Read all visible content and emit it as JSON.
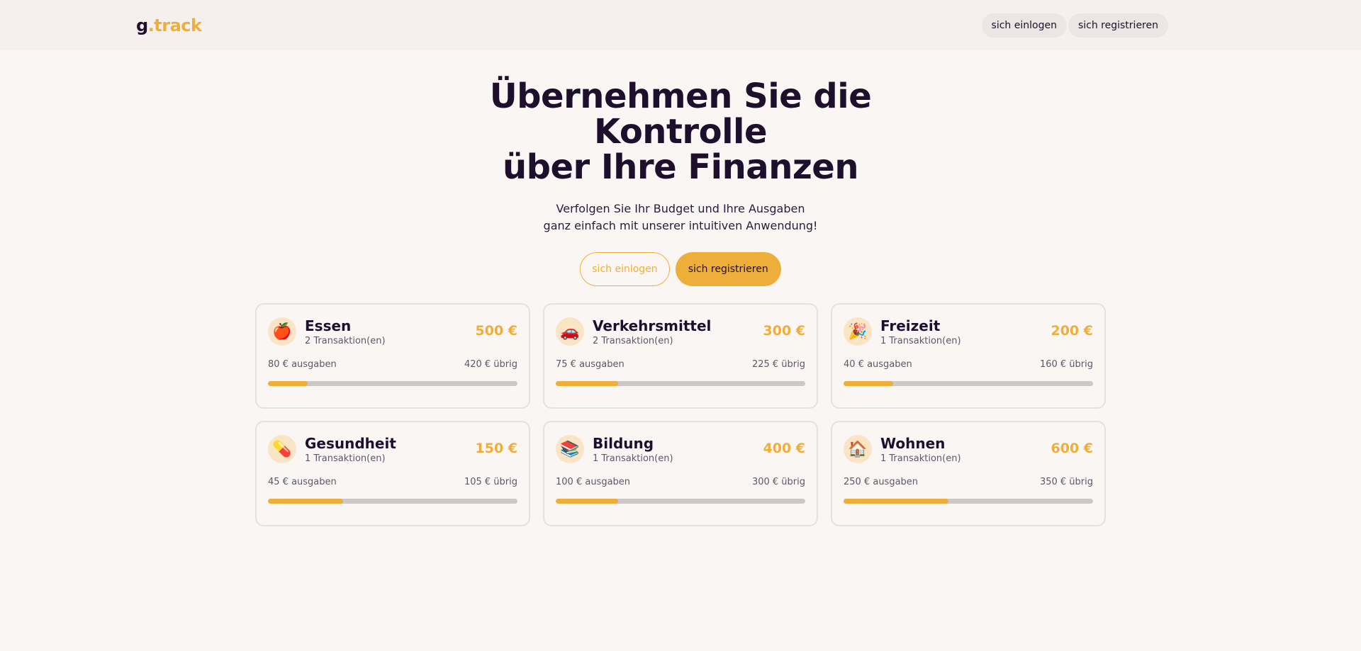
{
  "header": {
    "logo_g": "g",
    "logo_rest": ".track",
    "login_label": "sich einlogen",
    "register_label": "sich registrieren"
  },
  "hero": {
    "title_line1": "Übernehmen Sie die Kontrolle",
    "title_line2": "über Ihre Finanzen",
    "subtitle_line1": "Verfolgen Sie Ihr Budget und Ihre Ausgaben",
    "subtitle_line2": "ganz einfach mit unserer intuitiven Anwendung!",
    "login_label": "sich einlogen",
    "register_label": "sich registrieren"
  },
  "categories": [
    {
      "name": "Essen",
      "icon": "apple-icon",
      "glyph": "🍎",
      "transactions": "2 Transaktion(en)",
      "budget": "500 €",
      "spent": "80 € ausgaben",
      "left": "420 € übrig",
      "progress": 16
    },
    {
      "name": "Verkehrsmittel",
      "icon": "car-icon",
      "glyph": "🚗",
      "transactions": "2 Transaktion(en)",
      "budget": "300 €",
      "spent": "75 € ausgaben",
      "left": "225 € übrig",
      "progress": 25
    },
    {
      "name": "Freizeit",
      "icon": "party-popper-icon",
      "glyph": "🎉",
      "transactions": "1 Transaktion(en)",
      "budget": "200 €",
      "spent": "40 € ausgaben",
      "left": "160 € übrig",
      "progress": 20
    },
    {
      "name": "Gesundheit",
      "icon": "pill-icon",
      "glyph": "💊",
      "transactions": "1 Transaktion(en)",
      "budget": "150 €",
      "spent": "45 € ausgaben",
      "left": "105 € übrig",
      "progress": 30
    },
    {
      "name": "Bildung",
      "icon": "books-icon",
      "glyph": "📚",
      "transactions": "1 Transaktion(en)",
      "budget": "400 €",
      "spent": "100 € ausgaben",
      "left": "300 € übrig",
      "progress": 25
    },
    {
      "name": "Wohnen",
      "icon": "house-icon",
      "glyph": "🏠",
      "transactions": "1 Transaktion(en)",
      "budget": "600 €",
      "spent": "250 € ausgaben",
      "left": "350 € übrig",
      "progress": 42
    }
  ],
  "colors": {
    "accent": "#eeae3a",
    "text": "#1e0f2d",
    "background": "#faf6f4"
  }
}
